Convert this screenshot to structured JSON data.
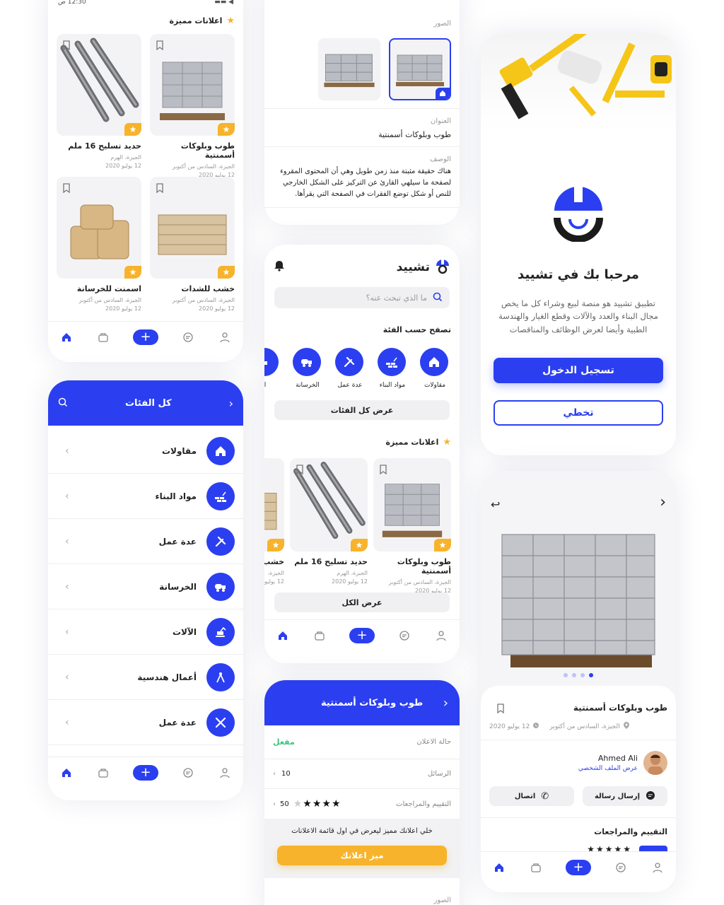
{
  "colors": {
    "primary": "#2b3ff0",
    "star": "#f7b32b",
    "active": "#3cc47c"
  },
  "nav": {
    "items": [
      "home-icon",
      "bag-icon",
      "plus-icon",
      "chat-icon",
      "user-icon"
    ]
  },
  "feed": {
    "header_left": "12:30 ص",
    "featured_title": "اعلانات مميزة",
    "products": [
      {
        "title": "طوب وبلوكات أسمنتية",
        "loc": "الجيزة، السادس من أكتوبر",
        "date": "12 يوليو 2020"
      },
      {
        "title": "حديد تسليح 16 ملم",
        "loc": "الجيزة، الهرم",
        "date": "12 يوليو 2020"
      },
      {
        "title": "خشب للشدات",
        "loc": "الجيزة، السادس من أكتوبر",
        "date": "12 يوليو 2020"
      },
      {
        "title": "اسمنت للخرسانة",
        "loc": "الجيزة، السادس من أكتوبر",
        "date": "12 يوليو 2020"
      }
    ]
  },
  "categories": {
    "title": "كل الفئات",
    "items": [
      {
        "label": "مقاولات",
        "icon": "house-icon"
      },
      {
        "label": "مواد البناء",
        "icon": "bricks-icon"
      },
      {
        "label": "عدة عمل",
        "icon": "tools-icon"
      },
      {
        "label": "الخرسانة",
        "icon": "mixer-truck-icon"
      },
      {
        "label": "الآلات",
        "icon": "excavator-icon"
      },
      {
        "label": "أعمال هندسية",
        "icon": "compass-icon"
      },
      {
        "label": "عدة عمل",
        "icon": "tools-cross-icon"
      }
    ]
  },
  "detail_top": {
    "images_label": "الصور",
    "title_label": "العنوان",
    "title_value": "طوب وبلوكات أسمنتية",
    "desc_label": "الوصف",
    "desc_value": "هناك حقيقة مثبتة منذ زمن طويل وهي أن المحتوى المقروء لصفحة ما سيلهي القارئ عن التركيز على الشكل الخارجي للنص أو شكل توضع الفقرات في الصفحة التي يقرأها."
  },
  "home": {
    "app_name": "تشييد",
    "search_placeholder": "ما الذي تبحث عنه؟",
    "browse_title": "تصفح حسب الفئة",
    "cats": [
      "مقاولات",
      "مواد البناء",
      "عدة عمل",
      "الخرسانة",
      "ا"
    ],
    "view_all_cats": "عرض كل الفئات",
    "featured_title": "اعلانات مميزة",
    "products": [
      {
        "title": "طوب وبلوكات أسمنتية",
        "loc": "الجيزة، السادس من أكتوبر",
        "date": "12 يوليو 2020"
      },
      {
        "title": "حديد تسليح 16 ملم",
        "loc": "الجيزة، الهرم",
        "date": "12 يوليو 2020"
      },
      {
        "title": "خشب",
        "loc": "الجيزة،",
        "date": "12 يوليو 2020"
      }
    ],
    "view_all": "عرض الكل"
  },
  "my_ad": {
    "title": "طوب وبلوكات أسمنتية",
    "status_label": "حالة الاعلان",
    "status_value": "مفعل",
    "messages_label": "الرسائل",
    "messages_value": "10",
    "reviews_label": "التقييم والمراجعات",
    "reviews_value": "50",
    "stars": 4,
    "promo_text": "خلي اعلانك مميز ليعرض في اول قائمة الاعلانات",
    "promo_button": "ميز اعلانك",
    "images_label": "الصور"
  },
  "welcome": {
    "title": "مرحبا بك في تشييد",
    "text": "تطبيق تشييد هو منصة لبيع وشراء كل ما يخص مجال البناء والعدد والآلات وقطع الغيار والهندسة الطبية وأيضا لعرض الوظائف والمناقصات",
    "login": "تسجيل الدخول",
    "skip": "تخطي"
  },
  "product": {
    "title": "طوب وبلوكات أسمنتية",
    "loc": "الجيزة، السادس من أكتوبر",
    "date": "12 يوليو 2020",
    "seller_name": "Ahmed Ali",
    "seller_link": "عرض الملف الشخصي",
    "send_message": "إرسال رسالة",
    "call": "اتصال",
    "reviews_title": "التقييم والمراجعات",
    "slide_count": 4,
    "slide_active": 4
  }
}
